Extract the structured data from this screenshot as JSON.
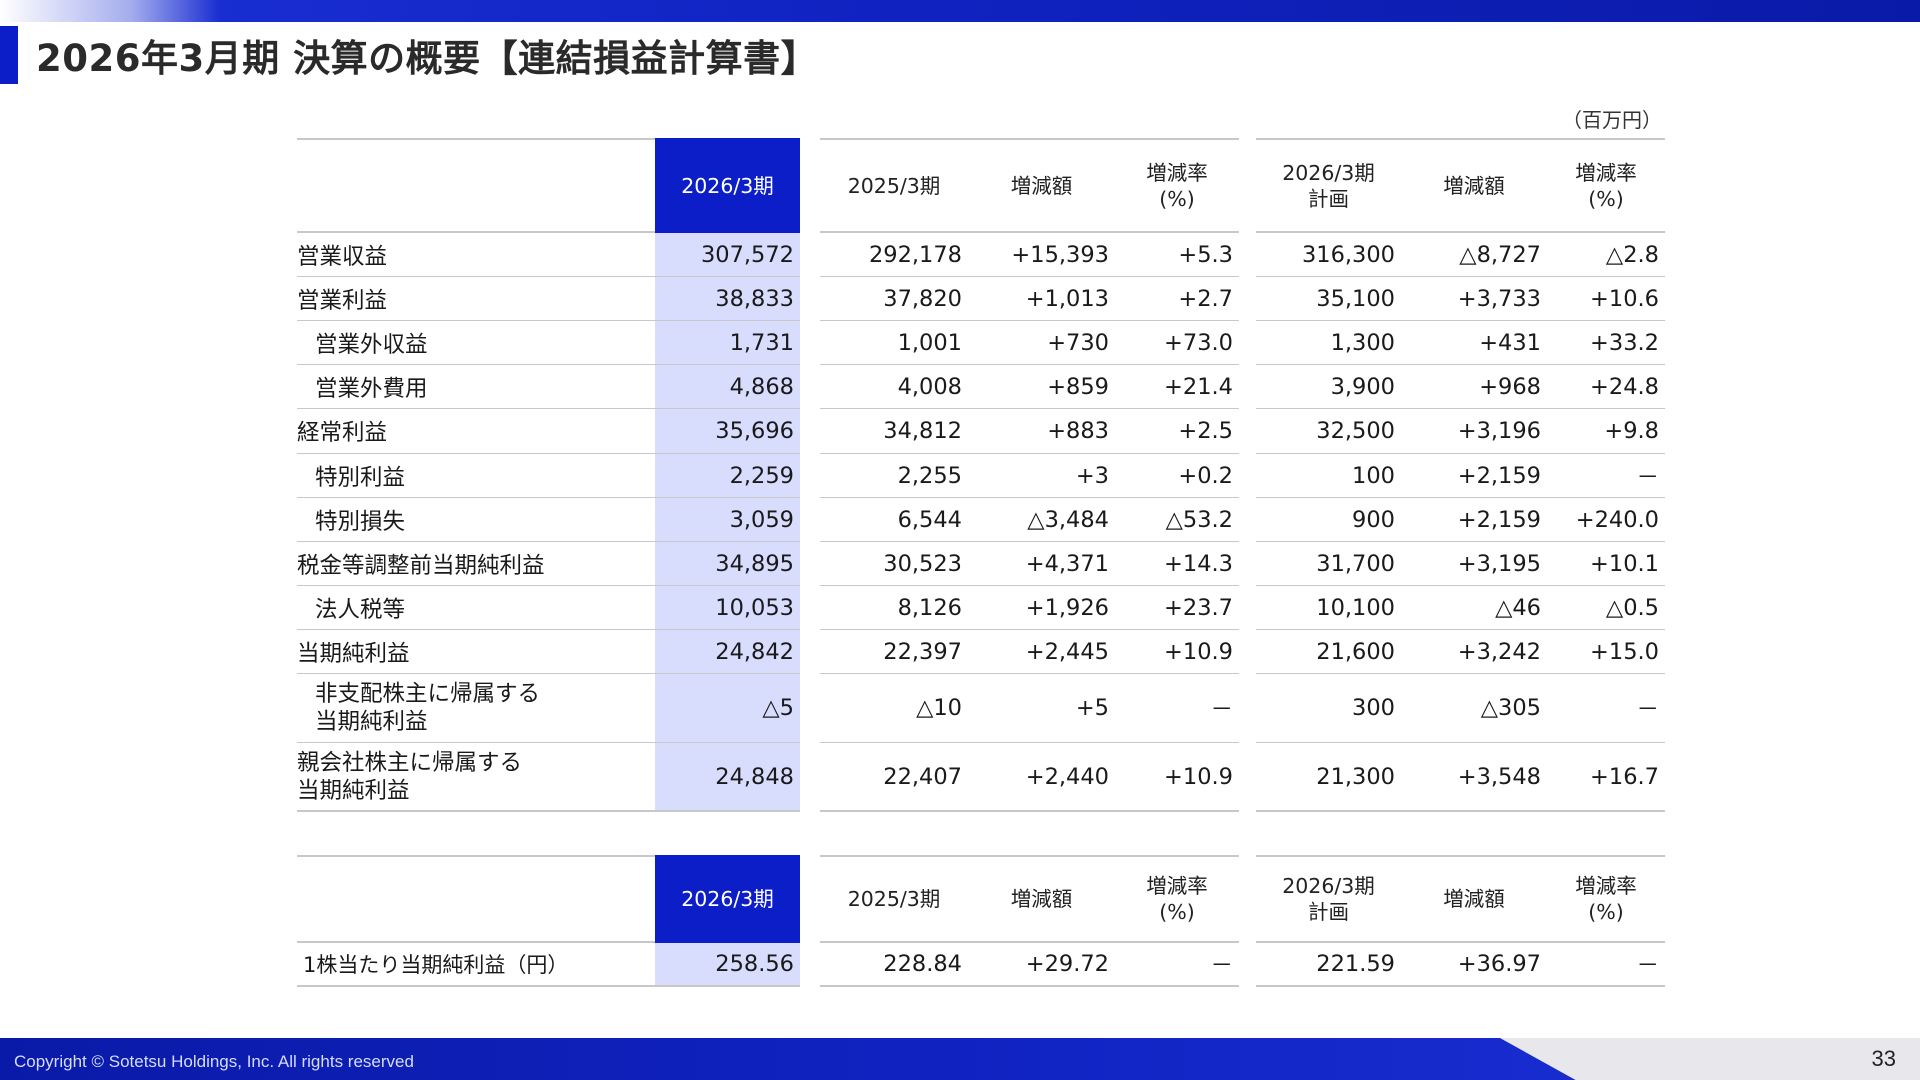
{
  "page": {
    "title": "2026年3月期 決算の概要【連結損益計算書】",
    "unit": "（百万円）",
    "copyright": "Copyright © Sotetsu Holdings, Inc. All rights reserved",
    "page_number": "33"
  },
  "colors": {
    "accent": "#0b1ec7",
    "highlight_column": "#d8dcfd",
    "rule": "#c8c8c8"
  },
  "income_table": {
    "headers": {
      "current": "2026/3期",
      "prev": "2025/3期",
      "diff": "増減額",
      "rate1": "増減率",
      "rate2": "(%)",
      "plan1": "2026/3期",
      "plan2": "計画",
      "plan_diff": "増減額",
      "plan_rate1": "増減率",
      "plan_rate2": "(%)"
    },
    "rows": [
      {
        "label": "営業収益",
        "current": "307,572",
        "prev": "292,178",
        "diff": "+15,393",
        "rate": "+5.3",
        "plan": "316,300",
        "plan_diff": "△8,727",
        "plan_rate": "△2.8"
      },
      {
        "label": "営業利益",
        "current": "38,833",
        "prev": "37,820",
        "diff": "+1,013",
        "rate": "+2.7",
        "plan": "35,100",
        "plan_diff": "+3,733",
        "plan_rate": "+10.6"
      },
      {
        "label": "営業外収益",
        "current": "1,731",
        "prev": "1,001",
        "diff": "+730",
        "rate": "+73.0",
        "plan": "1,300",
        "plan_diff": "+431",
        "plan_rate": "+33.2"
      },
      {
        "label": "営業外費用",
        "current": "4,868",
        "prev": "4,008",
        "diff": "+859",
        "rate": "+21.4",
        "plan": "3,900",
        "plan_diff": "+968",
        "plan_rate": "+24.8"
      },
      {
        "label": "経常利益",
        "current": "35,696",
        "prev": "34,812",
        "diff": "+883",
        "rate": "+2.5",
        "plan": "32,500",
        "plan_diff": "+3,196",
        "plan_rate": "+9.8"
      },
      {
        "label": "特別利益",
        "current": "2,259",
        "prev": "2,255",
        "diff": "+3",
        "rate": "+0.2",
        "plan": "100",
        "plan_diff": "+2,159",
        "plan_rate": "－"
      },
      {
        "label": "特別損失",
        "current": "3,059",
        "prev": "6,544",
        "diff": "△3,484",
        "rate": "△53.2",
        "plan": "900",
        "plan_diff": "+2,159",
        "plan_rate": "+240.0"
      },
      {
        "label": "税金等調整前当期純利益",
        "current": "34,895",
        "prev": "30,523",
        "diff": "+4,371",
        "rate": "+14.3",
        "plan": "31,700",
        "plan_diff": "+3,195",
        "plan_rate": "+10.1"
      },
      {
        "label": "法人税等",
        "current": "10,053",
        "prev": "8,126",
        "diff": "+1,926",
        "rate": "+23.7",
        "plan": "10,100",
        "plan_diff": "△46",
        "plan_rate": "△0.5"
      },
      {
        "label": "当期純利益",
        "current": "24,842",
        "prev": "22,397",
        "diff": "+2,445",
        "rate": "+10.9",
        "plan": "21,600",
        "plan_diff": "+3,242",
        "plan_rate": "+15.0"
      },
      {
        "label1": "非支配株主に帰属する",
        "label2": "当期純利益",
        "current": "△5",
        "prev": "△10",
        "diff": "+5",
        "rate": "－",
        "plan": "300",
        "plan_diff": "△305",
        "plan_rate": "－"
      },
      {
        "label1": "親会社株主に帰属する",
        "label2": "当期純利益",
        "current": "24,848",
        "prev": "22,407",
        "diff": "+2,440",
        "rate": "+10.9",
        "plan": "21,300",
        "plan_diff": "+3,548",
        "plan_rate": "+16.7"
      }
    ]
  },
  "eps_table": {
    "headers": {
      "current": "2026/3期",
      "prev": "2025/3期",
      "diff": "増減額",
      "rate1": "増減率",
      "rate2": "(%)",
      "plan1": "2026/3期",
      "plan2": "計画",
      "plan_diff": "増減額",
      "plan_rate1": "増減率",
      "plan_rate2": "(%)"
    },
    "row": {
      "label": "1株当たり当期純利益（円）",
      "current": "258.56",
      "prev": "228.84",
      "diff": "+29.72",
      "rate": "－",
      "plan": "221.59",
      "plan_diff": "+36.97",
      "plan_rate": "－"
    }
  }
}
